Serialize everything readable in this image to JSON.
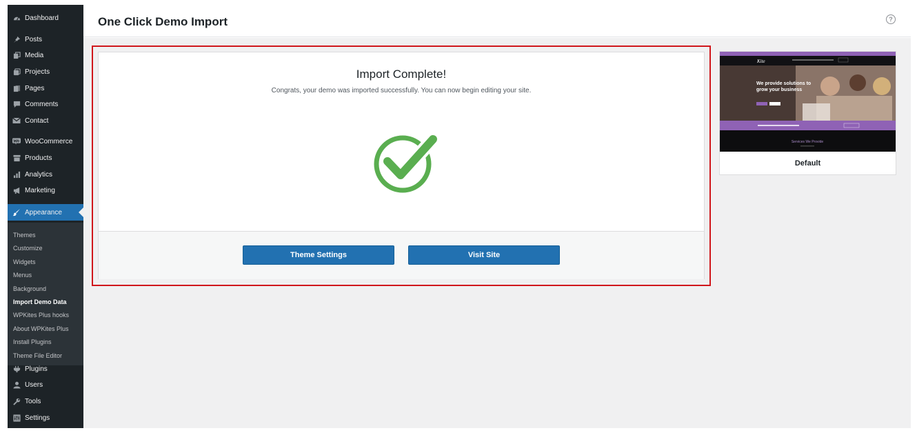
{
  "sidebar": {
    "items": [
      {
        "label": "Dashboard",
        "icon": "dashboard-icon"
      },
      {
        "label": "Posts",
        "icon": "pin-icon"
      },
      {
        "label": "Media",
        "icon": "media-icon"
      },
      {
        "label": "Projects",
        "icon": "projects-icon"
      },
      {
        "label": "Pages",
        "icon": "pages-icon"
      },
      {
        "label": "Comments",
        "icon": "comment-icon"
      },
      {
        "label": "Contact",
        "icon": "mail-icon"
      },
      {
        "label": "WooCommerce",
        "icon": "woocommerce-icon"
      },
      {
        "label": "Products",
        "icon": "archive-icon"
      },
      {
        "label": "Analytics",
        "icon": "chart-bar-icon"
      },
      {
        "label": "Marketing",
        "icon": "megaphone-icon"
      },
      {
        "label": "Appearance",
        "icon": "brush-icon"
      },
      {
        "label": "Plugins",
        "icon": "plug-icon"
      },
      {
        "label": "Users",
        "icon": "user-icon"
      },
      {
        "label": "Tools",
        "icon": "wrench-icon"
      },
      {
        "label": "Settings",
        "icon": "settings-icon"
      }
    ],
    "submenu": [
      "Themes",
      "Customize",
      "Widgets",
      "Menus",
      "Background",
      "Import Demo Data",
      "WPKites Plus hooks",
      "About WPKites Plus",
      "Install Plugins",
      "Theme File Editor"
    ]
  },
  "header": {
    "title": "One Click Demo Import",
    "help_glyph": "?"
  },
  "import": {
    "title": "Import Complete!",
    "message": "Congrats, your demo was imported successfully. You can now begin editing your site.",
    "theme_settings_label": "Theme Settings",
    "visit_site_label": "Visit Site"
  },
  "demo": {
    "label": "Default",
    "hero_line1": "We provide solutions to",
    "hero_line2": "grow your business",
    "services_heading": "Services We Provide"
  },
  "colors": {
    "sidebar_bg": "#1d2327",
    "accent": "#2271b1",
    "success": "#5aae50",
    "highlight_border": "#d0161b",
    "demo_purple": "#8f62b5"
  }
}
